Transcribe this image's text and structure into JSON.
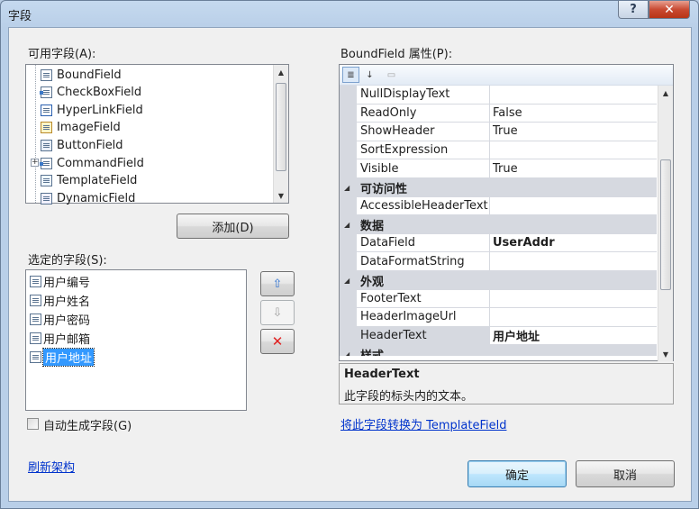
{
  "window": {
    "title": "字段",
    "help_label": "?",
    "close_label": "✕"
  },
  "available": {
    "label": "可用字段(A):",
    "items": [
      {
        "label": "BoundField",
        "icon": "bound-field-icon"
      },
      {
        "label": "CheckBoxField",
        "icon": "checkbox-field-icon"
      },
      {
        "label": "HyperLinkField",
        "icon": "hyperlink-field-icon"
      },
      {
        "label": "ImageField",
        "icon": "image-field-icon"
      },
      {
        "label": "ButtonField",
        "icon": "button-field-icon"
      },
      {
        "label": "CommandField",
        "icon": "command-field-icon",
        "expander": "+"
      },
      {
        "label": "TemplateField",
        "icon": "template-field-icon"
      },
      {
        "label": "DynamicField",
        "icon": "dynamic-field-icon"
      }
    ],
    "add_button": "添加(D)"
  },
  "selected": {
    "label": "选定的字段(S):",
    "items": [
      "用户编号",
      "用户姓名",
      "用户密码",
      "用户邮箱",
      "用户地址"
    ],
    "selected_index": 4,
    "move_up_icon": "⇧",
    "move_down_icon": "⇩",
    "delete_icon": "✕"
  },
  "auto_generate": {
    "label": "自动生成字段(G)",
    "checked": false
  },
  "refresh_link": "刷新架构",
  "properties": {
    "label": "BoundField 属性(P):",
    "toolbar": {
      "categorized_icon": "≣",
      "alphabetical_icon": "↓",
      "property_pages_icon": "▭"
    },
    "rows": [
      {
        "kind": "prop",
        "name": "NullDisplayText",
        "value": ""
      },
      {
        "kind": "prop",
        "name": "ReadOnly",
        "value": "False"
      },
      {
        "kind": "prop",
        "name": "ShowHeader",
        "value": "True"
      },
      {
        "kind": "prop",
        "name": "SortExpression",
        "value": ""
      },
      {
        "kind": "prop",
        "name": "Visible",
        "value": "True"
      },
      {
        "kind": "cat",
        "name": "可访问性"
      },
      {
        "kind": "prop",
        "name": "AccessibleHeaderText",
        "value": ""
      },
      {
        "kind": "cat",
        "name": "数据"
      },
      {
        "kind": "prop",
        "name": "DataField",
        "value": "UserAddr",
        "bold": true
      },
      {
        "kind": "prop",
        "name": "DataFormatString",
        "value": ""
      },
      {
        "kind": "cat",
        "name": "外观"
      },
      {
        "kind": "prop",
        "name": "FooterText",
        "value": ""
      },
      {
        "kind": "prop",
        "name": "HeaderImageUrl",
        "value": ""
      },
      {
        "kind": "prop",
        "name": "HeaderText",
        "value": "用户地址",
        "bold": true,
        "selected": true
      },
      {
        "kind": "cat",
        "name": "样式"
      }
    ],
    "description": {
      "title": "HeaderText",
      "text": "此字段的标头内的文本。"
    }
  },
  "convert_link": "将此字段转换为 TemplateField",
  "ok_button": "确定",
  "cancel_button": "取消"
}
